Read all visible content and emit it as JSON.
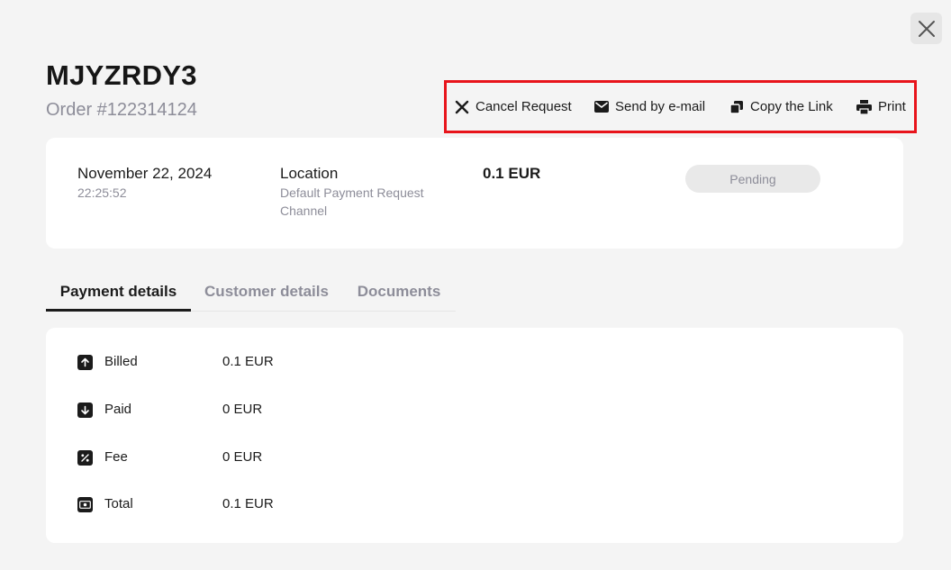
{
  "header": {
    "title": "MJYZRDY3",
    "order_number": "Order #122314124"
  },
  "actions": {
    "cancel_label": "Cancel Request",
    "email_label": "Send by e-mail",
    "copy_label": "Copy the Link",
    "print_label": "Print"
  },
  "summary": {
    "date": "November 22, 2024",
    "time": "22:25:52",
    "location_label": "Location",
    "location_value": "Default Payment Request Channel",
    "amount": "0.1 EUR",
    "status": "Pending"
  },
  "tabs": [
    {
      "label": "Payment details",
      "active": true
    },
    {
      "label": "Customer details",
      "active": false
    },
    {
      "label": "Documents",
      "active": false
    }
  ],
  "payment_details": [
    {
      "icon": "arrow-up-icon",
      "label": "Billed",
      "value": "0.1 EUR"
    },
    {
      "icon": "arrow-down-icon",
      "label": "Paid",
      "value": "0 EUR"
    },
    {
      "icon": "percent-icon",
      "label": "Fee",
      "value": "0 EUR"
    },
    {
      "icon": "banknote-icon",
      "label": "Total",
      "value": "0.1 EUR"
    }
  ],
  "colors": {
    "background": "#f4f4f4",
    "card": "#ffffff",
    "text": "#1b1b1b",
    "muted": "#8d8d99",
    "highlight_border": "#e8141b",
    "status_bg": "#e9e9e9"
  }
}
